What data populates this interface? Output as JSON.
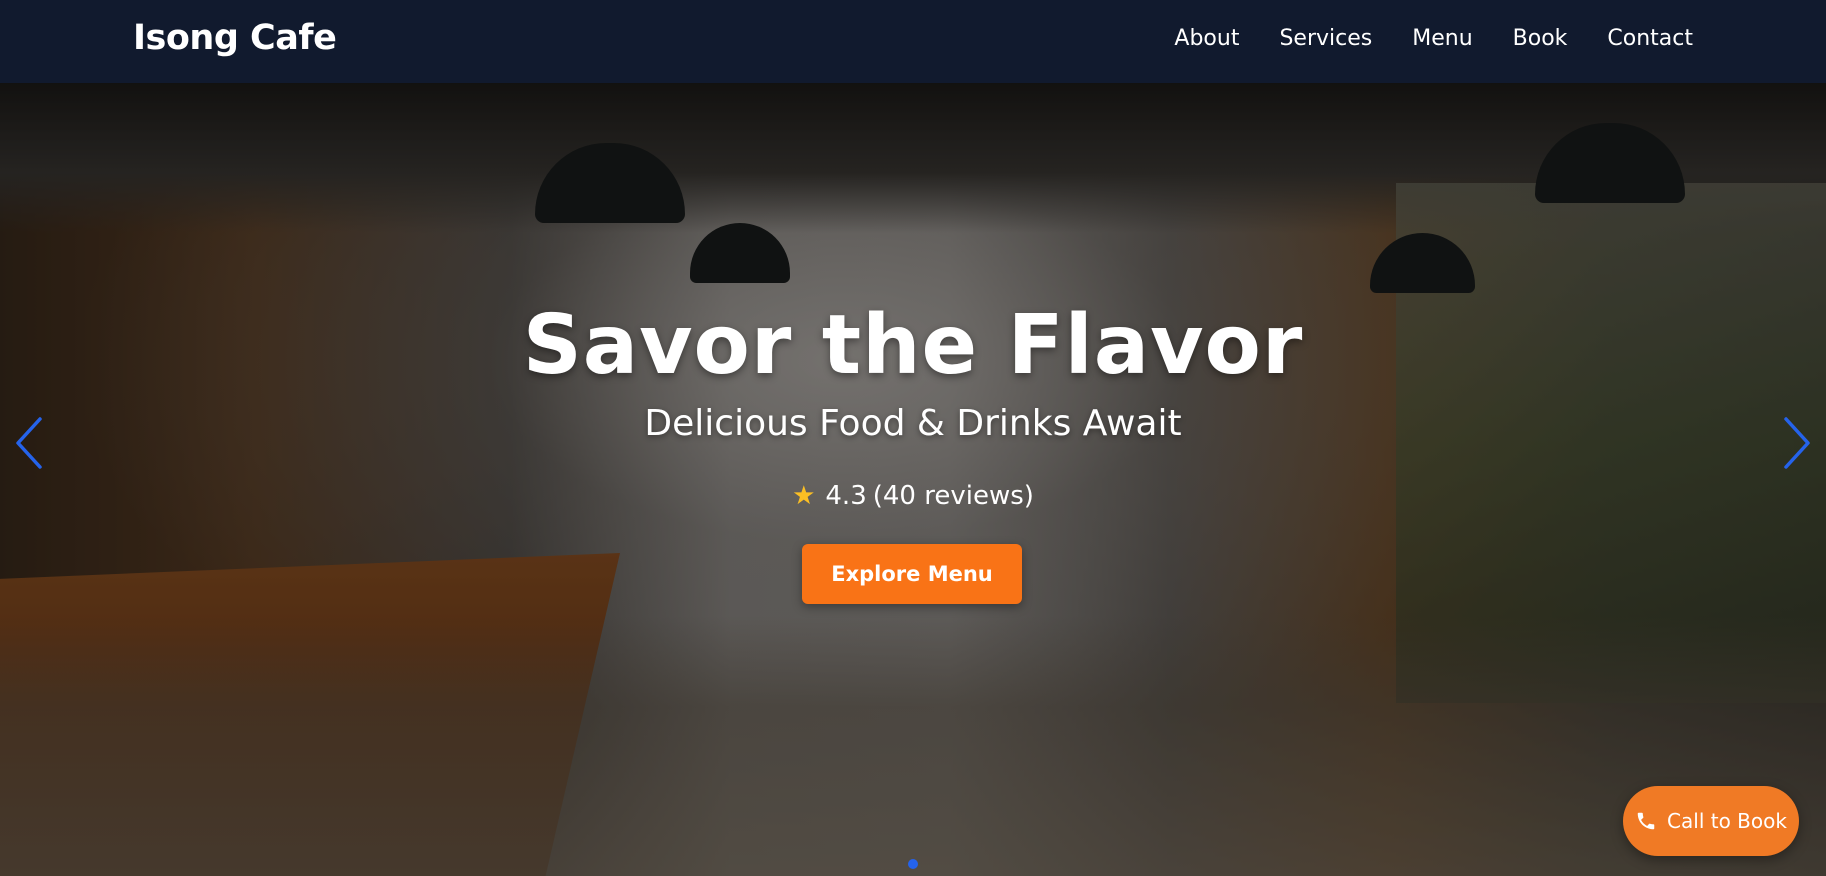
{
  "navbar": {
    "brand": "Isong Cafe",
    "links": [
      {
        "label": "About"
      },
      {
        "label": "Services"
      },
      {
        "label": "Menu"
      },
      {
        "label": "Book"
      },
      {
        "label": "Contact"
      }
    ]
  },
  "hero": {
    "title": "Savor the Flavor",
    "subtitle": "Delicious Food & Drinks Await",
    "rating_value": "4.3",
    "rating_reviews": "(40 reviews)",
    "star_icon": "star-icon",
    "cta_label": "Explore Menu",
    "slide_count": 1,
    "active_slide": 0
  },
  "floating": {
    "call_label": "Call to Book",
    "icon": "phone-icon"
  },
  "colors": {
    "navbar_bg": "#111a2e",
    "accent": "#f97316",
    "indicator_active": "#2563eb",
    "arrow": "#2563eb",
    "star": "#fbbf24"
  }
}
